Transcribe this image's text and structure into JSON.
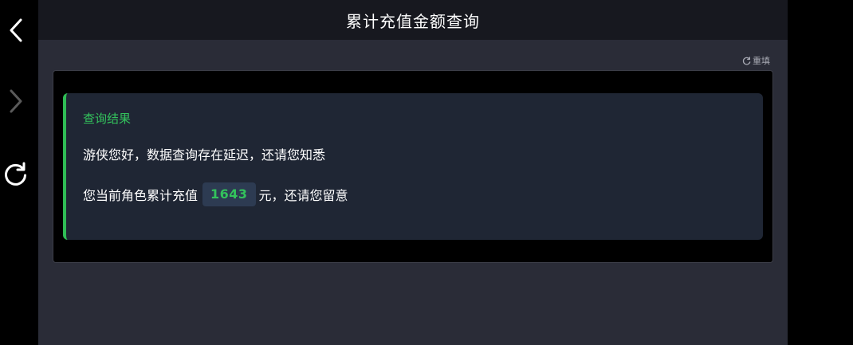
{
  "header": {
    "title": "累计充值金额查询"
  },
  "toolbar": {
    "reset_label": "重填",
    "reset_icon": "refresh-icon"
  },
  "nav": {
    "back_icon": "chevron-left-icon",
    "forward_icon": "chevron-right-icon",
    "reload_icon": "reload-icon"
  },
  "result": {
    "title": "查询结果",
    "line1": "游侠您好，数据查询存在延迟，还请您知悉",
    "line2_prefix": "您当前角色累计充值",
    "amount": "1643",
    "line2_suffix": "元，还请您留意"
  },
  "colors": {
    "accent": "#33c25c",
    "header_bg": "#17181f",
    "page_bg": "#2a2c37",
    "card_bg": "#1f2634",
    "badge_bg": "#2d3b52"
  }
}
